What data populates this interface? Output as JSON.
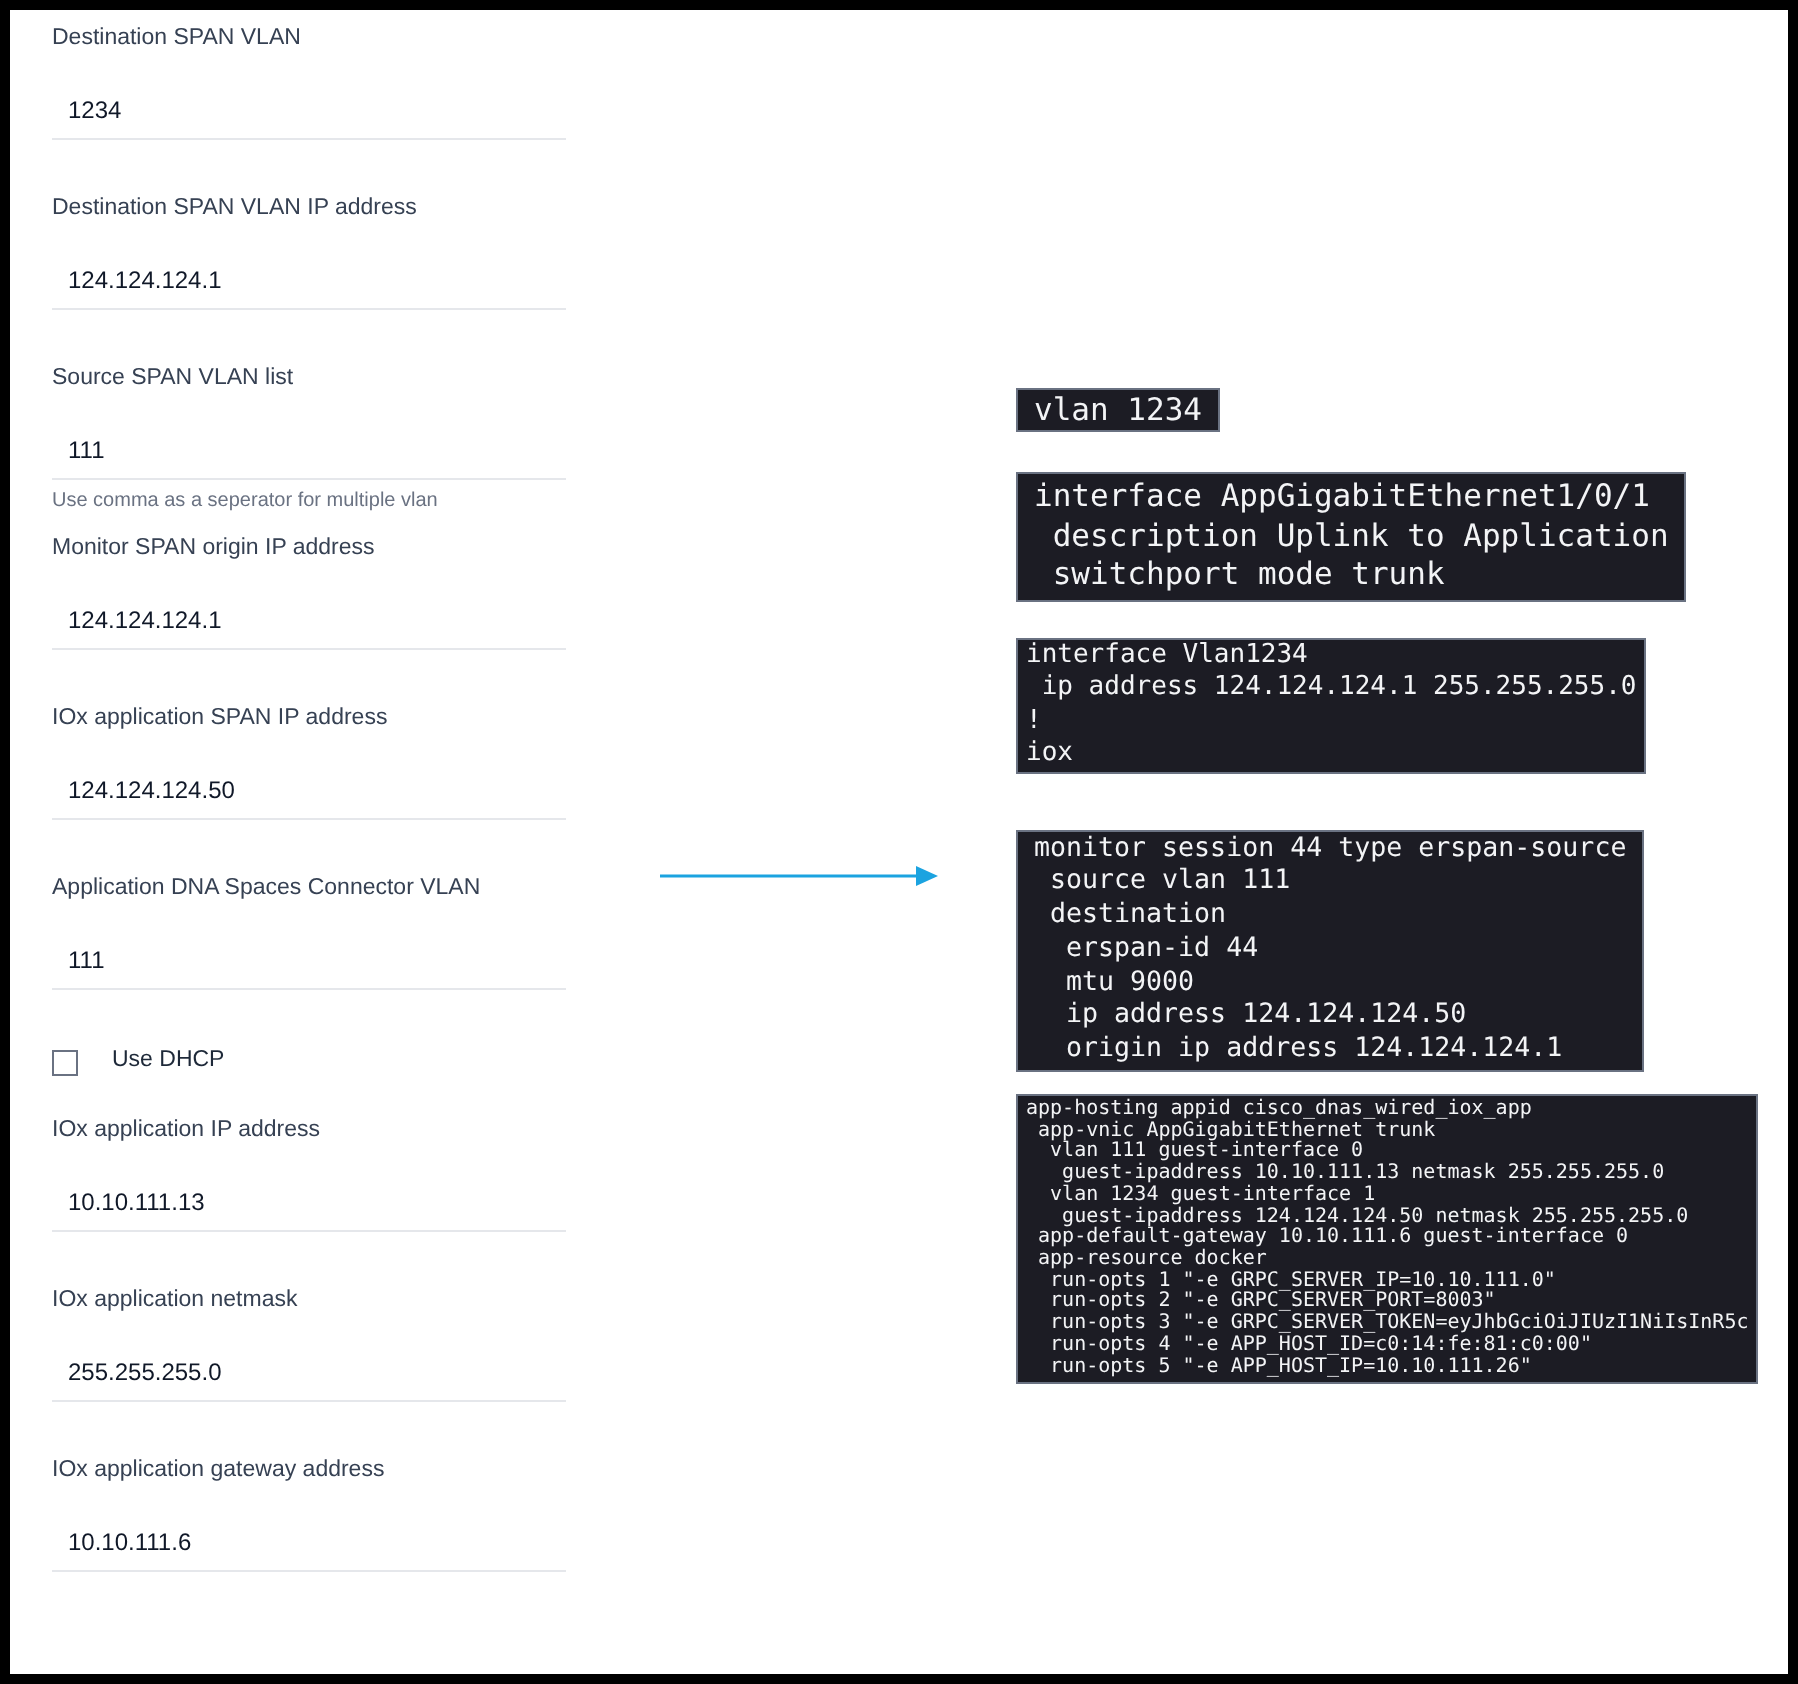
{
  "form": {
    "fields": [
      {
        "kind": "text",
        "label": "Destination SPAN VLAN",
        "value": "1234"
      },
      {
        "kind": "text",
        "label": "Destination SPAN VLAN IP address",
        "value": "124.124.124.1"
      },
      {
        "kind": "text",
        "label": "Source SPAN VLAN list",
        "value": "111",
        "hint": "Use comma as a seperator for multiple vlan"
      },
      {
        "kind": "text",
        "label": "Monitor SPAN origin IP address",
        "value": "124.124.124.1"
      },
      {
        "kind": "text",
        "label": "IOx application SPAN IP address",
        "value": "124.124.124.50"
      },
      {
        "kind": "text",
        "label": "Application DNA Spaces Connector VLAN",
        "value": "111"
      },
      {
        "kind": "checkbox",
        "label": "Use DHCP",
        "checked": false
      },
      {
        "kind": "text",
        "label": "IOx application IP address",
        "value": "10.10.111.13"
      },
      {
        "kind": "text",
        "label": "IOx application netmask",
        "value": "255.255.255.0"
      },
      {
        "kind": "text",
        "label": "IOx application gateway address",
        "value": "10.10.111.6"
      }
    ]
  },
  "config_blocks": [
    {
      "lines": [
        "vlan 1234"
      ]
    },
    {
      "lines": [
        "interface AppGigabitEthernet1/0/1",
        " description Uplink to Application",
        " switchport mode trunk"
      ]
    },
    {
      "lines": [
        "interface Vlan1234",
        " ip address 124.124.124.1 255.255.255.0",
        "!",
        "iox"
      ]
    },
    {
      "lines": [
        "monitor session 44 type erspan-source",
        " source vlan 111",
        " destination",
        "  erspan-id 44",
        "  mtu 9000",
        "  ip address 124.124.124.50",
        "  origin ip address 124.124.124.1"
      ]
    },
    {
      "lines": [
        "app-hosting appid cisco_dnas_wired_iox_app",
        " app-vnic AppGigabitEthernet trunk",
        "  vlan 111 guest-interface 0",
        "   guest-ipaddress 10.10.111.13 netmask 255.255.255.0",
        "  vlan 1234 guest-interface 1",
        "   guest-ipaddress 124.124.124.50 netmask 255.255.255.0",
        " app-default-gateway 10.10.111.6 guest-interface 0",
        " app-resource docker",
        "  run-opts 1 \"-e GRPC_SERVER_IP=10.10.111.0\"",
        "  run-opts 2 \"-e GRPC_SERVER_PORT=8003\"",
        "  run-opts 3 \"-e GRPC_SERVER_TOKEN=eyJhbGciOiJIUzI1NiIsInR5c",
        "  run-opts 4 \"-e APP_HOST_ID=c0:14:fe:81:c0:00\"",
        "  run-opts 5 \"-e APP_HOST_IP=10.10.111.26\""
      ]
    }
  ]
}
